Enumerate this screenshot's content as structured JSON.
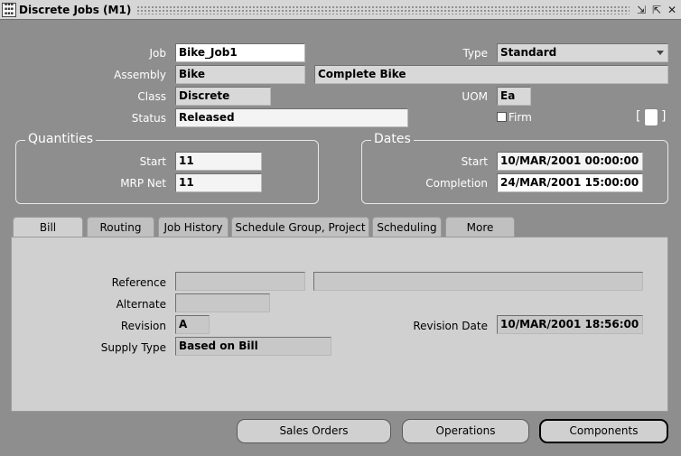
{
  "window": {
    "title": "Discrete Jobs (M1)"
  },
  "header": {
    "job_label": "Job",
    "job_value": "Bike_Job1",
    "type_label": "Type",
    "type_value": "Standard",
    "assembly_label": "Assembly",
    "assembly_value": "Bike",
    "assembly_desc": "Complete Bike",
    "class_label": "Class",
    "class_value": "Discrete",
    "uom_label": "UOM",
    "uom_value": "Ea",
    "status_label": "Status",
    "status_value": "Released",
    "firm_label": "Firm"
  },
  "quantities": {
    "title": "Quantities",
    "start_label": "Start",
    "start_value": "11",
    "mrp_label": "MRP Net",
    "mrp_value": "11"
  },
  "dates": {
    "title": "Dates",
    "start_label": "Start",
    "start_value": "10/MAR/2001 00:00:00",
    "completion_label": "Completion",
    "completion_value": "24/MAR/2001 15:00:00"
  },
  "tabs": [
    {
      "label": "Bill"
    },
    {
      "label": "Routing"
    },
    {
      "label": "Job History"
    },
    {
      "label": "Schedule Group, Project"
    },
    {
      "label": "Scheduling"
    },
    {
      "label": "More"
    }
  ],
  "bill": {
    "reference_label": "Reference",
    "reference_value": "",
    "reference_desc": "",
    "alternate_label": "Alternate",
    "alternate_value": "",
    "revision_label": "Revision",
    "revision_value": "A",
    "revision_date_label": "Revision Date",
    "revision_date_value": "10/MAR/2001 18:56:00",
    "supply_type_label": "Supply Type",
    "supply_type_value": "Based on Bill"
  },
  "buttons": {
    "sales_orders": "Sales Orders",
    "operations": "Operations",
    "components": "Components"
  },
  "icons": {
    "app_icon": "oracle-form-icon",
    "minimize": "minimize-icon",
    "maximize": "maximize-icon",
    "close": "close-icon",
    "dropdown": "chevron-down-icon"
  }
}
